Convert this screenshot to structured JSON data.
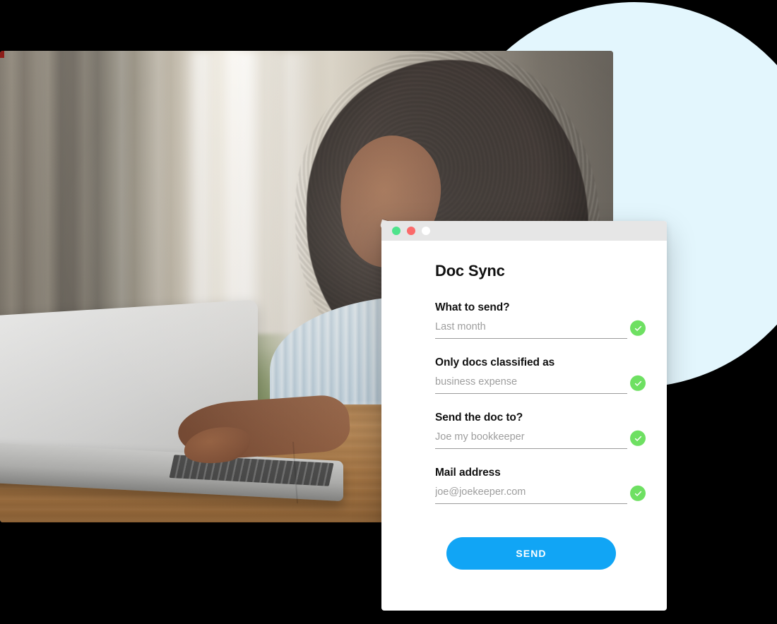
{
  "window": {
    "traffic_lights": [
      {
        "name": "minimize-dot",
        "color": "#4ee38b"
      },
      {
        "name": "close-dot",
        "color": "#fb6a6a"
      },
      {
        "name": "maximize-dot",
        "color": "#ffffff"
      }
    ]
  },
  "card": {
    "title": "Doc Sync",
    "fields": [
      {
        "label": "What to send?",
        "placeholder": "Last month",
        "value": "",
        "validated": true,
        "icon": "check-circle-icon"
      },
      {
        "label": "Only docs classified as",
        "placeholder": "business expense",
        "value": "",
        "validated": true,
        "icon": "check-circle-icon"
      },
      {
        "label": "Send the doc to?",
        "placeholder": "Joe my bookkeeper",
        "value": "",
        "validated": true,
        "icon": "check-circle-icon"
      },
      {
        "label": "Mail address",
        "placeholder": "joe@joekeeper.com",
        "value": "",
        "validated": true,
        "icon": "check-circle-icon"
      }
    ],
    "submit_label": "SEND"
  },
  "decor": {
    "blob_color": "#e3f6fd",
    "accent_color": "#11a5f5",
    "success_color": "#6ee062",
    "titlebar_color": "#e6e6e6",
    "photo_alt": "Smiling woman with curly hair typing on a white laptop at a wooden desk, notebook beside her"
  }
}
